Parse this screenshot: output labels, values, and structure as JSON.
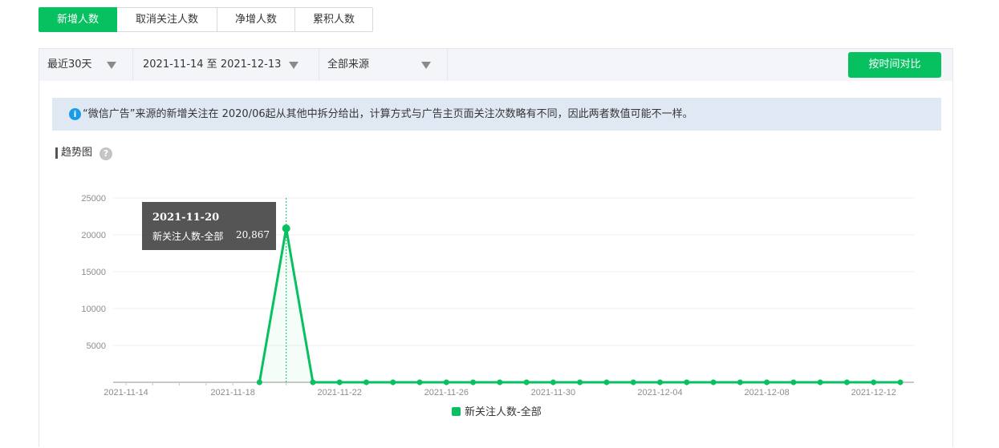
{
  "tabs": [
    {
      "label": "新增人数",
      "active": true
    },
    {
      "label": "取消关注人数",
      "active": false
    },
    {
      "label": "净增人数",
      "active": false
    },
    {
      "label": "累积人数",
      "active": false
    }
  ],
  "filters": {
    "period": "最近30天",
    "date_range": "2021-11-14 至 2021-12-13",
    "source": "全部来源",
    "compare_button": "按时间对比"
  },
  "notice": {
    "icon": "info-icon",
    "text": "“微信广告”来源的新增关注在 2020/06起从其他中拆分给出，计算方式与广告主页面关注次数略有不同，因此两者数值可能不一样。"
  },
  "section": {
    "title": "趋势图",
    "help_icon": "?"
  },
  "tooltip": {
    "date": "2021-11-20",
    "series_label": "新关注人数-全部",
    "value": "20,867"
  },
  "colors": {
    "accent": "#07c160",
    "info": "#1a9be8"
  },
  "chart_data": {
    "type": "line",
    "x": [
      "2021-11-14",
      "2021-11-15",
      "2021-11-16",
      "2021-11-17",
      "2021-11-18",
      "2021-11-19",
      "2021-11-20",
      "2021-11-21",
      "2021-11-22",
      "2021-11-23",
      "2021-11-24",
      "2021-11-25",
      "2021-11-26",
      "2021-11-27",
      "2021-11-28",
      "2021-11-29",
      "2021-11-30",
      "2021-12-01",
      "2021-12-02",
      "2021-12-03",
      "2021-12-04",
      "2021-12-05",
      "2021-12-06",
      "2021-12-07",
      "2021-12-08",
      "2021-12-09",
      "2021-12-10",
      "2021-12-11",
      "2021-12-12",
      "2021-12-13"
    ],
    "series": [
      {
        "name": "新关注人数-全部",
        "values": [
          null,
          null,
          null,
          null,
          null,
          0,
          20867,
          0,
          0,
          0,
          0,
          0,
          0,
          0,
          0,
          0,
          0,
          0,
          0,
          0,
          0,
          0,
          0,
          0,
          0,
          0,
          0,
          0,
          0,
          0
        ]
      }
    ],
    "x_tick_labels": [
      "2021-11-14",
      "2021-11-18",
      "2021-11-22",
      "2021-11-26",
      "2021-11-30",
      "2021-12-04",
      "2021-12-08",
      "2021-12-12"
    ],
    "y_tick_labels": [
      "5000",
      "10000",
      "15000",
      "20000",
      "25000"
    ],
    "ylim": [
      0,
      25000
    ],
    "grid": true,
    "legend": "bottom-center",
    "highlight": {
      "x": "2021-11-20"
    }
  }
}
